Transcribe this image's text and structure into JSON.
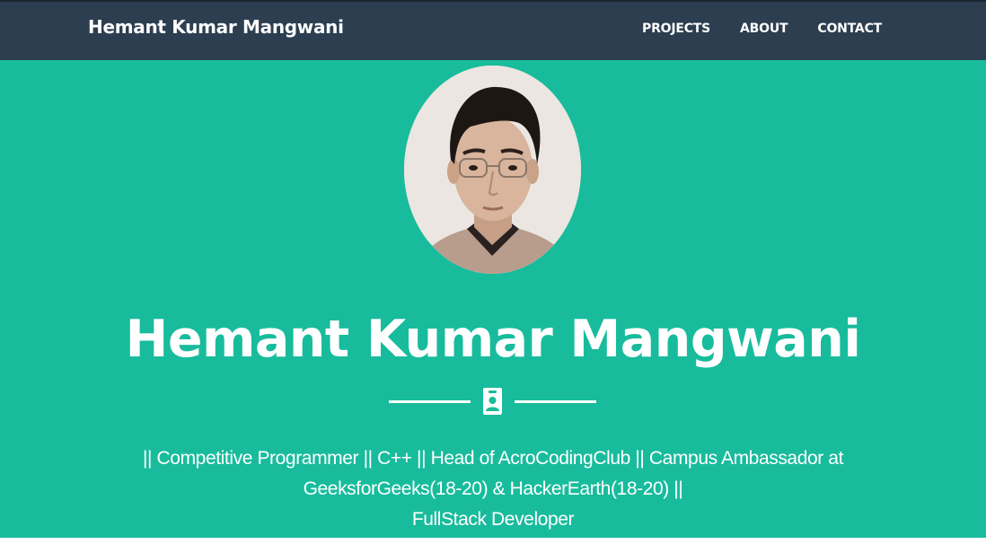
{
  "navbar": {
    "brand": "Hemant Kumar Mangwani",
    "links": [
      {
        "label": "PROJECTS"
      },
      {
        "label": "ABOUT"
      },
      {
        "label": "CONTACT"
      }
    ],
    "bg_color": "#2c3e50"
  },
  "hero": {
    "bg_color": "#18bc9c",
    "avatar_icon": "profile-photo",
    "title": "Hemant Kumar Mangwani",
    "divider_icon": "id-badge-icon",
    "tagline_lines": [
      "|| Competitive Programmer || C++ || Head of AcroCodingClub || Campus Ambassador at",
      "GeeksforGeeks(18-20) & HackerEarth(18-20) ||",
      "FullStack Developer"
    ]
  }
}
